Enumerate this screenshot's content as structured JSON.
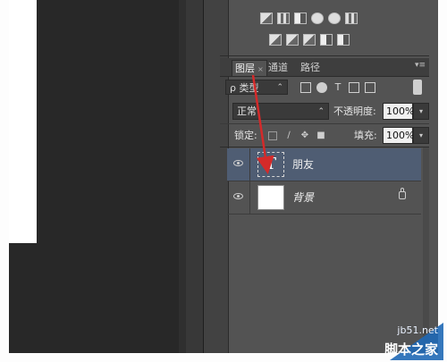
{
  "layers_panel": {
    "tabs": [
      {
        "label": "图层",
        "close": "×"
      },
      {
        "label": "通道"
      },
      {
        "label": "路径"
      }
    ],
    "panel_menu": "▾≡",
    "filter": {
      "label": "ρ 类型",
      "caret": "⌃"
    },
    "blend_mode": {
      "value": "正常",
      "caret": "⌃"
    },
    "opacity": {
      "label": "不透明度:",
      "value": "100%",
      "button": "▾"
    },
    "lock": {
      "label": "锁定:"
    },
    "fill": {
      "label": "填充:",
      "value": "100%",
      "button": "▾"
    },
    "layers": [
      {
        "name": "朋友",
        "thumb": "T",
        "selected": true
      },
      {
        "name": "背景",
        "locked": true
      }
    ]
  },
  "watermark": {
    "url": "jb51.net",
    "name": "脚本之家"
  },
  "colors": {
    "panel": "#535353",
    "selected_layer": "#4f5d73",
    "arrow": "#d42a2a"
  }
}
